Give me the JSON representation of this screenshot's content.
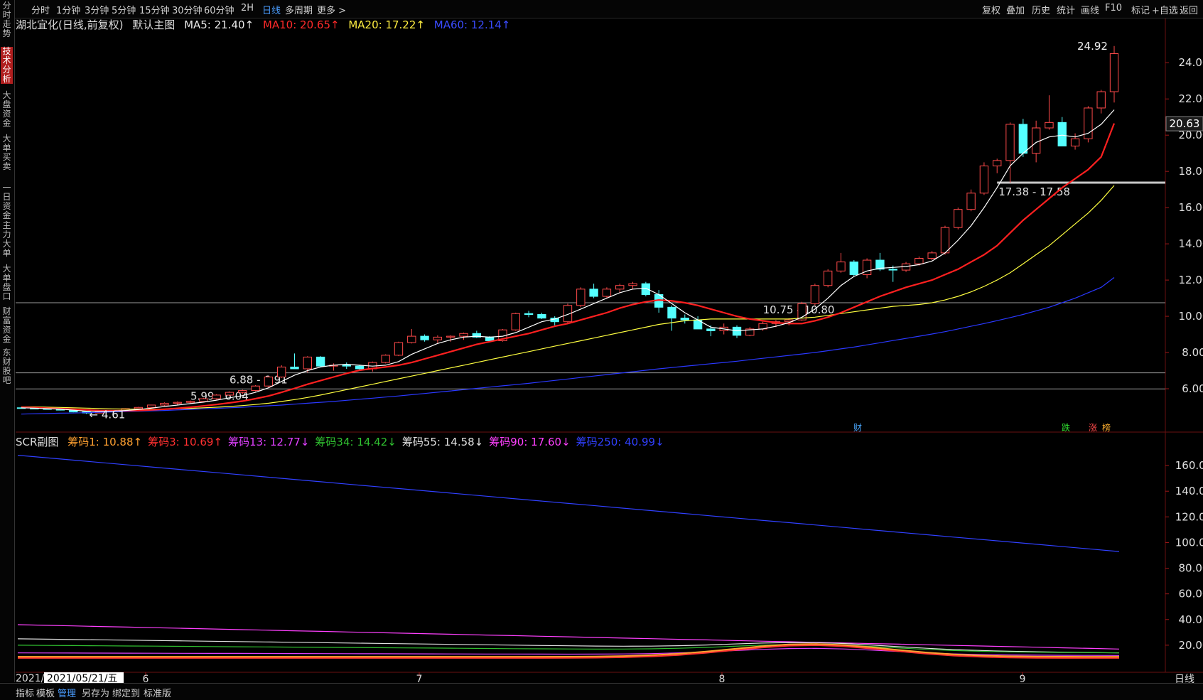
{
  "top_menu": {
    "left": [
      "分时",
      "1分钟",
      "3分钟",
      "5分钟",
      "15分钟",
      "30分钟",
      "60分钟",
      "2H",
      "日线",
      "多周期",
      "更多 >"
    ],
    "active": "日线",
    "right": [
      "复权",
      "叠加",
      "历史",
      "统计",
      "画线",
      "F10",
      "标记",
      "+自选",
      "返回"
    ]
  },
  "side_tabs": [
    "分时走势",
    "技术分析",
    "大盘资金",
    "大单买卖",
    "一日资金",
    "主力大单",
    "大单盘口",
    "财富资金",
    "东财股吧"
  ],
  "side_active": "技术分析",
  "main_legend": {
    "stock": "湖北宜化(日线,前复权)",
    "indicator": "默认主图",
    "ma5": "MA5: 21.40↑",
    "ma10": "MA10: 20.65↑",
    "ma20": "MA20: 17.22↑",
    "ma60": "MA60: 12.14↑"
  },
  "sub_legend": {
    "name": "SCR副图",
    "items": [
      "筹码1: 10.88↑",
      "筹码3: 10.69↑",
      "筹码13: 12.77↓",
      "筹码34: 14.42↓",
      "筹码55: 14.58↓",
      "筹码90: 17.60↓",
      "筹码250: 40.99↓"
    ]
  },
  "colors": {
    "up": "#ff4a4a",
    "down": "#54ffff",
    "ma5": "#ffffff",
    "ma10": "#ff2020",
    "ma20": "#ffff40",
    "ma60": "#2a38ff",
    "sub1": "#ffa030",
    "sub3": "#ff3030",
    "sub13": "#e040ff",
    "sub34": "#30c030",
    "sub55": "#e0e0e0",
    "sub90": "#ff40ff",
    "sub250": "#3040ff"
  },
  "x_axis": {
    "labels": [
      "2021/05/21/五",
      "6",
      "7",
      "8",
      "9"
    ],
    "date_prefix": "2021/"
  },
  "period_label": "日线",
  "bottom_menu": [
    "指标",
    "模板",
    "管理",
    "另存为",
    "绑定到",
    "标准版"
  ],
  "bottom_active": "管理",
  "event_markers": [
    "财",
    "跌",
    "涨",
    "榜"
  ],
  "price_tag": "20.63",
  "chart_data": [
    {
      "type": "candlestick",
      "ylim": [
        4.0,
        25.5
      ],
      "yticks": [
        6.0,
        8.0,
        10.0,
        12.0,
        14.0,
        16.0,
        18.0,
        20.0,
        22.0,
        24.0
      ],
      "ohlc": [
        [
          4.95,
          5.0,
          4.9,
          4.93
        ],
        [
          4.92,
          4.96,
          4.88,
          4.9
        ],
        [
          4.9,
          4.93,
          4.85,
          4.87
        ],
        [
          4.87,
          4.9,
          4.8,
          4.82
        ],
        [
          4.82,
          4.85,
          4.7,
          4.72
        ],
        [
          4.72,
          4.75,
          4.61,
          4.66
        ],
        [
          4.66,
          4.75,
          4.64,
          4.73
        ],
        [
          4.73,
          4.82,
          4.7,
          4.8
        ],
        [
          4.8,
          4.92,
          4.78,
          4.9
        ],
        [
          4.9,
          5.0,
          4.87,
          4.97
        ],
        [
          4.97,
          5.12,
          4.95,
          5.1
        ],
        [
          5.1,
          5.25,
          5.05,
          5.2
        ],
        [
          5.2,
          5.3,
          5.1,
          5.25
        ],
        [
          5.25,
          5.35,
          5.2,
          5.3
        ],
        [
          5.3,
          5.5,
          5.25,
          5.45
        ],
        [
          5.45,
          5.7,
          5.4,
          5.65
        ],
        [
          5.65,
          5.85,
          5.6,
          5.8
        ],
        [
          5.8,
          5.95,
          5.7,
          5.9
        ],
        [
          5.9,
          6.2,
          5.85,
          6.15
        ],
        [
          6.15,
          6.7,
          6.1,
          6.65
        ],
        [
          6.65,
          7.3,
          6.6,
          7.2
        ],
        [
          7.2,
          7.95,
          7.1,
          7.1
        ],
        [
          7.1,
          7.8,
          6.9,
          7.75
        ],
        [
          7.75,
          7.8,
          7.2,
          7.25
        ],
        [
          7.25,
          7.4,
          7.0,
          7.3
        ],
        [
          7.3,
          7.45,
          7.1,
          7.25
        ],
        [
          7.25,
          7.3,
          7.0,
          7.1
        ],
        [
          7.1,
          7.5,
          6.95,
          7.45
        ],
        [
          7.45,
          7.9,
          7.4,
          7.85
        ],
        [
          7.85,
          8.6,
          7.8,
          8.55
        ],
        [
          8.55,
          9.3,
          8.5,
          8.9
        ],
        [
          8.9,
          9.0,
          8.6,
          8.7
        ],
        [
          8.7,
          8.95,
          8.5,
          8.85
        ],
        [
          8.85,
          8.95,
          8.6,
          8.9
        ],
        [
          8.9,
          9.1,
          8.7,
          9.05
        ],
        [
          9.05,
          9.2,
          8.8,
          8.85
        ],
        [
          8.85,
          8.9,
          8.6,
          8.65
        ],
        [
          8.65,
          9.3,
          8.6,
          9.25
        ],
        [
          9.25,
          10.2,
          9.2,
          10.15
        ],
        [
          10.15,
          10.3,
          9.95,
          10.1
        ],
        [
          10.1,
          10.2,
          9.85,
          9.9
        ],
        [
          9.9,
          10.0,
          9.5,
          9.7
        ],
        [
          9.7,
          10.7,
          9.6,
          10.6
        ],
        [
          10.6,
          11.6,
          10.5,
          11.5
        ],
        [
          11.5,
          11.8,
          11.0,
          11.1
        ],
        [
          11.1,
          11.6,
          11.0,
          11.5
        ],
        [
          11.5,
          11.8,
          11.3,
          11.7
        ],
        [
          11.7,
          11.9,
          11.5,
          11.8
        ],
        [
          11.8,
          11.9,
          11.1,
          11.2
        ],
        [
          11.2,
          11.45,
          10.2,
          10.5
        ],
        [
          10.5,
          10.6,
          9.2,
          9.9
        ],
        [
          9.9,
          10.1,
          9.6,
          9.8
        ],
        [
          9.8,
          10.0,
          9.5,
          9.3
        ],
        [
          9.3,
          9.5,
          8.9,
          9.2
        ],
        [
          9.2,
          9.6,
          9.0,
          9.4
        ],
        [
          9.4,
          9.5,
          8.8,
          8.95
        ],
        [
          8.95,
          9.4,
          8.9,
          9.3
        ],
        [
          9.3,
          9.7,
          9.2,
          9.6
        ],
        [
          9.6,
          9.8,
          9.4,
          9.7
        ],
        [
          9.7,
          9.9,
          9.5,
          9.8
        ],
        [
          9.8,
          10.8,
          9.75,
          10.7
        ],
        [
          10.7,
          11.8,
          10.6,
          11.7
        ],
        [
          11.7,
          12.6,
          11.6,
          12.5
        ],
        [
          12.5,
          13.5,
          12.4,
          13.0
        ],
        [
          13.0,
          13.1,
          12.2,
          12.3
        ],
        [
          12.3,
          13.2,
          12.1,
          13.1
        ],
        [
          13.1,
          13.5,
          12.5,
          12.6
        ],
        [
          12.6,
          12.8,
          11.9,
          12.55
        ],
        [
          12.55,
          13.0,
          12.45,
          12.9
        ],
        [
          12.9,
          13.3,
          12.8,
          13.2
        ],
        [
          13.2,
          13.6,
          13.1,
          13.5
        ],
        [
          13.5,
          15.0,
          13.4,
          14.9
        ],
        [
          14.9,
          16.0,
          14.8,
          15.9
        ],
        [
          15.9,
          17.0,
          15.8,
          16.8
        ],
        [
          16.8,
          18.5,
          16.7,
          18.3
        ],
        [
          18.3,
          18.7,
          17.9,
          18.6
        ],
        [
          18.6,
          20.7,
          17.38,
          20.6
        ],
        [
          20.6,
          20.9,
          18.8,
          19.0
        ],
        [
          19.0,
          20.8,
          18.5,
          20.4
        ],
        [
          20.4,
          22.2,
          20.3,
          20.7
        ],
        [
          20.7,
          21.0,
          19.5,
          19.4
        ],
        [
          19.4,
          20.1,
          19.2,
          19.8
        ],
        [
          19.8,
          21.6,
          19.6,
          21.5
        ],
        [
          21.5,
          22.5,
          21.2,
          22.4
        ],
        [
          22.4,
          24.92,
          21.8,
          24.5
        ]
      ],
      "ma5": [
        4.95,
        4.93,
        4.9,
        4.88,
        4.82,
        4.76,
        4.75,
        4.76,
        4.8,
        4.85,
        4.93,
        5.02,
        5.1,
        5.18,
        5.26,
        5.37,
        5.5,
        5.62,
        5.8,
        6.05,
        6.4,
        6.75,
        7.0,
        7.2,
        7.3,
        7.35,
        7.3,
        7.25,
        7.3,
        7.5,
        7.9,
        8.2,
        8.5,
        8.7,
        8.85,
        8.9,
        8.85,
        8.9,
        9.1,
        9.4,
        9.7,
        9.85,
        10.1,
        10.4,
        10.7,
        11.0,
        11.3,
        11.5,
        11.55,
        11.2,
        10.7,
        10.2,
        9.8,
        9.4,
        9.3,
        9.2,
        9.25,
        9.3,
        9.45,
        9.65,
        9.95,
        10.4,
        11.0,
        11.7,
        12.2,
        12.5,
        12.65,
        12.7,
        12.75,
        12.85,
        13.05,
        13.5,
        14.2,
        15.0,
        16.0,
        17.1,
        18.3,
        19.0,
        19.6,
        19.9,
        20.0,
        19.9,
        20.1,
        20.6,
        21.4
      ],
      "ma10": [
        4.98,
        4.96,
        4.93,
        4.9,
        4.87,
        4.83,
        4.8,
        4.79,
        4.79,
        4.8,
        4.83,
        4.87,
        4.92,
        4.98,
        5.05,
        5.13,
        5.22,
        5.32,
        5.45,
        5.6,
        5.8,
        6.02,
        6.25,
        6.45,
        6.65,
        6.85,
        7.02,
        7.12,
        7.2,
        7.3,
        7.45,
        7.65,
        7.85,
        8.05,
        8.25,
        8.45,
        8.6,
        8.75,
        8.9,
        9.05,
        9.25,
        9.45,
        9.6,
        9.8,
        10.0,
        10.2,
        10.45,
        10.65,
        10.8,
        10.9,
        10.85,
        10.75,
        10.6,
        10.4,
        10.2,
        10.0,
        9.85,
        9.75,
        9.65,
        9.6,
        9.6,
        9.75,
        9.95,
        10.2,
        10.5,
        10.8,
        11.1,
        11.35,
        11.6,
        11.8,
        12.0,
        12.3,
        12.6,
        13.0,
        13.4,
        13.9,
        14.6,
        15.3,
        15.9,
        16.5,
        17.1,
        17.6,
        18.1,
        18.8,
        20.65
      ],
      "ma20": [
        5.0,
        5.0,
        4.98,
        4.97,
        4.95,
        4.93,
        4.91,
        4.89,
        4.88,
        4.87,
        4.87,
        4.88,
        4.9,
        4.92,
        4.95,
        4.98,
        5.02,
        5.07,
        5.13,
        5.2,
        5.3,
        5.4,
        5.52,
        5.65,
        5.8,
        5.95,
        6.1,
        6.25,
        6.4,
        6.55,
        6.7,
        6.85,
        7.0,
        7.15,
        7.3,
        7.45,
        7.6,
        7.75,
        7.9,
        8.05,
        8.2,
        8.35,
        8.5,
        8.65,
        8.8,
        8.95,
        9.1,
        9.25,
        9.4,
        9.55,
        9.65,
        9.75,
        9.8,
        9.85,
        9.85,
        9.85,
        9.85,
        9.85,
        9.85,
        9.85,
        9.9,
        9.95,
        10.05,
        10.15,
        10.25,
        10.35,
        10.45,
        10.55,
        10.6,
        10.65,
        10.75,
        10.9,
        11.1,
        11.35,
        11.65,
        12.0,
        12.4,
        12.9,
        13.4,
        13.9,
        14.5,
        15.1,
        15.7,
        16.4,
        17.22
      ],
      "ma60": [
        4.6,
        4.62,
        4.63,
        4.65,
        4.66,
        4.68,
        4.7,
        4.72,
        4.74,
        4.76,
        4.78,
        4.8,
        4.83,
        4.86,
        4.89,
        4.92,
        4.95,
        4.98,
        5.02,
        5.06,
        5.1,
        5.15,
        5.2,
        5.25,
        5.3,
        5.36,
        5.42,
        5.48,
        5.54,
        5.6,
        5.67,
        5.74,
        5.81,
        5.88,
        5.95,
        6.02,
        6.09,
        6.16,
        6.23,
        6.3,
        6.38,
        6.46,
        6.54,
        6.62,
        6.7,
        6.78,
        6.86,
        6.94,
        7.02,
        7.1,
        7.17,
        7.24,
        7.31,
        7.38,
        7.45,
        7.52,
        7.6,
        7.68,
        7.76,
        7.84,
        7.92,
        8.0,
        8.1,
        8.2,
        8.3,
        8.42,
        8.54,
        8.66,
        8.78,
        8.9,
        9.02,
        9.15,
        9.3,
        9.45,
        9.6,
        9.76,
        9.93,
        10.1,
        10.3,
        10.5,
        10.75,
        11.0,
        11.3,
        11.6,
        12.14
      ],
      "hlines": [
        {
          "value": 10.75,
          "label": "10.75 - 10.80"
        },
        {
          "value": 6.88,
          "label": "6.88 - 6.91"
        },
        {
          "value": 5.99,
          "label": "5.99 - 6.04"
        },
        {
          "value": 17.38,
          "label": "17.38 - 17.58"
        }
      ],
      "annotations": [
        {
          "text": "24.92",
          "value": 24.92
        },
        {
          "text": "← 4.61",
          "value": 4.61
        }
      ]
    },
    {
      "type": "line",
      "ylim": [
        0,
        175
      ],
      "yticks": [
        20.0,
        40.0,
        60.0,
        80.0,
        100.0,
        120.0,
        140.0,
        160.0
      ],
      "series": [
        {
          "name": "筹码250",
          "start": 168,
          "end": 93
        },
        {
          "name": "筹码90",
          "start": 36,
          "end": 17
        },
        {
          "name": "筹码55",
          "start": 25,
          "end": 14
        },
        {
          "name": "筹码34",
          "start": 20,
          "end": 14
        },
        {
          "name": "筹码13",
          "start": 14,
          "end": 12
        },
        {
          "name": "筹码3",
          "start": 10,
          "end": 10
        },
        {
          "name": "筹码1",
          "start": 11,
          "end": 11
        }
      ]
    }
  ]
}
